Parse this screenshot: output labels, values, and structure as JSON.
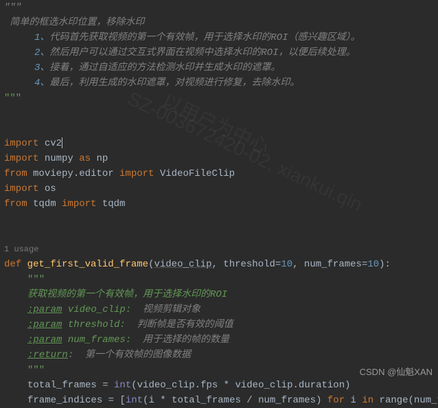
{
  "doc_top": {
    "l1": " 简单的框选水印位置，移除水印",
    "n1": "1、",
    "n2": "2、",
    "n3": "3、",
    "n4": "4、",
    "l2": "代码首先获取视频的第一个有效帧，用于选择水印的ROI（感兴趣区域）。",
    "l3": "然后用户可以通过交互式界面在视频中选择水印的ROI，以便后续处理。",
    "l4": "接着，通过自适应的方法检测水印并生成水印的遮罩。",
    "l5": "最后，利用生成的水印遮罩，对视频进行修复，去除水印。",
    "end": "\"\"\""
  },
  "imports": {
    "kw_import": "import",
    "kw_from": "from",
    "kw_as": "as",
    "cv2": " cv2",
    "numpy": " numpy ",
    "np": " np",
    "moviepy": " moviepy.editor ",
    "vfc": " VideoFileClip",
    "os": " os",
    "tqdm_pkg": " tqdm ",
    "tqdm": " tqdm"
  },
  "usage": "1 usage",
  "func": {
    "kw_def": "def",
    "name": " get_first_valid_frame",
    "open": "(",
    "p1": "video_clip",
    "sep1": ", threshold=",
    "th": "10",
    "sep2": ", num_frames=",
    "nf": "10",
    "close": "):",
    "doc_open": "\"\"\"",
    "d1": "获取视频的第一个有效帧，用于选择水印的ROI",
    "tag_param": ":param",
    "tag_return": ":return",
    "p1n": " video_clip: ",
    "p1d": " 视频剪辑对象",
    "p2n": " threshold: ",
    "p2d": " 判断帧是否有效的阈值",
    "p3n": " num_frames: ",
    "p3d": " 用于选择的帧的数量",
    "rd": ":  第一个有效帧的图像数据",
    "doc_close": "\"\"\"",
    "body1a": "total_frames = ",
    "int": "int",
    "body1b": "(video_clip.fps * video_clip.duration)",
    "body2a": "frame_indices = [",
    "body2b": "(i * total_frames / num_frames) ",
    "kw_for": "for",
    "body2c": " i ",
    "kw_in": "in",
    "body2d": " range(num_fram"
  },
  "watermark": {
    "w1": "以用户为中心\n",
    "w2": "SZ-003672420-02, xiankui.qin"
  },
  "footer": "CSDN @仙魁XAN"
}
